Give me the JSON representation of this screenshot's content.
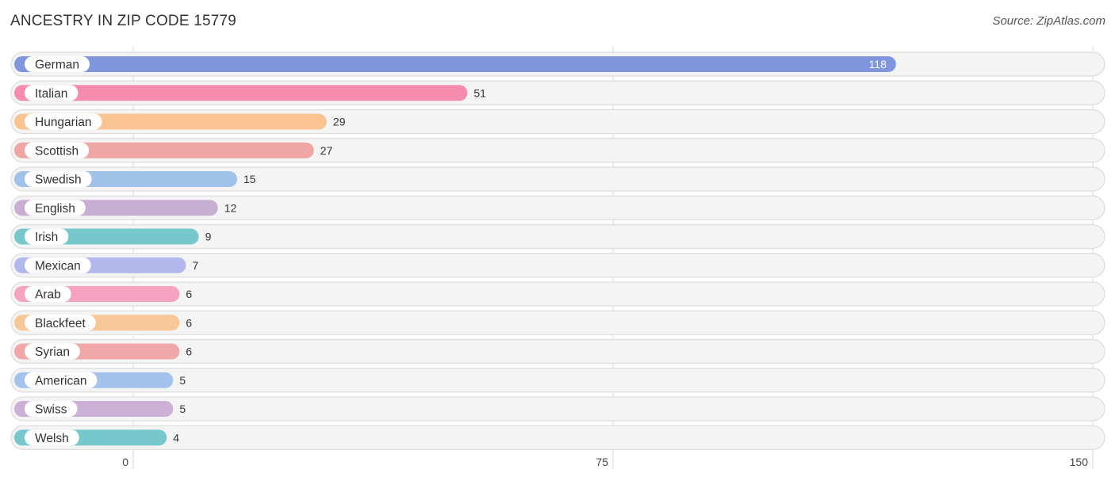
{
  "header": {
    "title": "ANCESTRY IN ZIP CODE 15779",
    "source": "Source: ZipAtlas.com"
  },
  "chart_data": {
    "type": "bar",
    "orientation": "horizontal",
    "title": "ANCESTRY IN ZIP CODE 15779",
    "xlabel": "",
    "ylabel": "",
    "xlim": [
      0,
      150
    ],
    "ticks": [
      0,
      75,
      150
    ],
    "grid": true,
    "categories": [
      "German",
      "Italian",
      "Hungarian",
      "Scottish",
      "Swedish",
      "English",
      "Irish",
      "Mexican",
      "Arab",
      "Blackfeet",
      "Syrian",
      "American",
      "Swiss",
      "Welsh"
    ],
    "values": [
      118,
      51,
      29,
      27,
      15,
      12,
      9,
      7,
      6,
      6,
      6,
      5,
      5,
      4
    ],
    "colors": [
      "#7f95dd",
      "#f68cad",
      "#f9c491",
      "#eea7a5",
      "#a0c1e8",
      "#c9aed3",
      "#76c8cc",
      "#b2b8eb",
      "#f6a2c0",
      "#f8c797",
      "#f0a7a7",
      "#a4c3ec",
      "#cdb0d6",
      "#76c8cc"
    ]
  }
}
